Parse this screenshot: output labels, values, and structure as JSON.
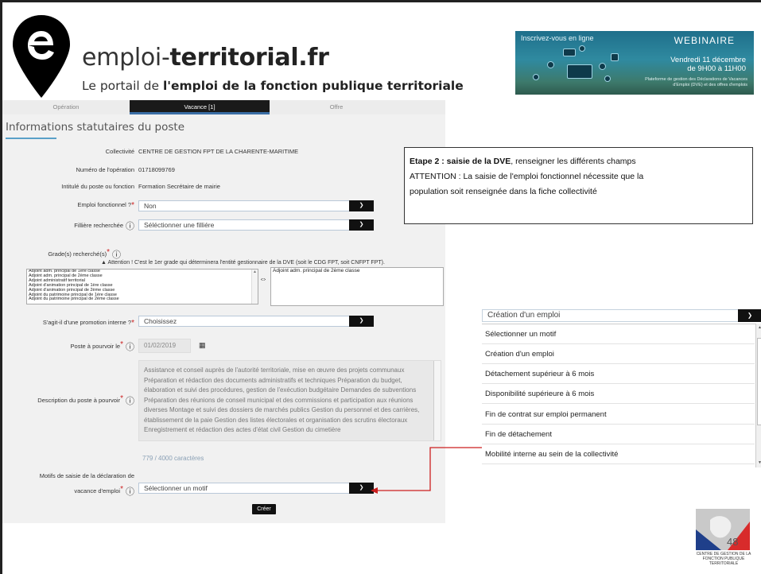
{
  "header": {
    "site_name_prefix": "emploi-",
    "site_name_bold": "territorial.fr",
    "tagline_prefix": "Le portail de ",
    "tagline_bold": "l'emploi de la fonction publique territoriale"
  },
  "banner": {
    "left_text": "Inscrivez-vous en ligne",
    "title": "WEBINAIRE",
    "date_line1": "Vendredi 11 décembre",
    "date_line2": "de 9H00 à 11H00",
    "description": "Plateforme de gestion des Déclarations de Vacances d'Emploi (DVE) et des offres d'emplois"
  },
  "tabs": [
    {
      "label": "Opération",
      "active": false
    },
    {
      "label": "Vacance [1]",
      "active": true
    },
    {
      "label": "Offre",
      "active": false
    }
  ],
  "form": {
    "section_title": "Informations statutaires du poste",
    "collectivite_label": "Collectivité",
    "collectivite_value": "CENTRE DE GESTION FPT DE LA CHARENTE-MARITIME",
    "operation_label": "Numéro de l'opération",
    "operation_value": "01718099769",
    "intitule_label": "Intitulé du poste ou fonction",
    "intitule_value": "Formation Secrétaire de mairie",
    "emploi_fonctionnel_label": "Emploi fonctionnel ?",
    "emploi_fonctionnel_value": "Non",
    "filiere_label": "Fillière recherchée",
    "filiere_value": "Séléctionner une filliére",
    "grade_label": "Grade(s) recherché(s)",
    "grade_warning": "Attention ! C'est le 1er grade qui déterminera l'entité gestionnaire de la DVE (soit le CDG FPT, soit CNFPT FPT).",
    "grade_options": [
      "Adjoint adm. principal de 1ère classe",
      "Adjoint adm. principal de 2ème classe",
      "Adjoint administratif territorial",
      "Adjoint d'animation principal de 1ère classe",
      "Adjoint d'animation principal de 2ème classe",
      "Adjoint du patrimoine principal de 1ère classe",
      "Adjoint du patrimoine principal de 2ème classe"
    ],
    "grade_selected": "Adjoint adm. principal de 2ème classe",
    "promotion_label": "S'agit-il d'une promotion interne ?",
    "promotion_value": "Choisissez",
    "poste_label": "Poste à pourvoir le",
    "poste_value": "01/02/2019",
    "description_label": "Description du poste à pourvoir",
    "description_value": "Assistance et conseil auprès de l'autorité territoriale, mise en œuvre des projets communaux Préparation et rédaction des documents administratifs et techniques Préparation du budget, élaboration et suivi des procédures, gestion de l'exécution budgétaire Demandes de subventions Préparation des réunions de conseil municipal et des commissions et participation aux réunions diverses Montage et suivi des dossiers de marchés publics Gestion du personnel et des carrières, établissement de la paie Gestion des listes électorales et organisation des scrutins électoraux Enregistrement et rédaction des actes d'état civil Gestion du cimetière",
    "char_count": "779 / 4000 caractères",
    "motifs_label_line1": "Motifs de saisie de la déclaration de",
    "motifs_label_line2": "vacance d'emploi",
    "motifs_value": "Sélectionner un motif",
    "create_button": "Créer"
  },
  "note": {
    "bold_part": "Etape 2 : saisie de la DVE",
    "rest_line1": ", renseigner les différents champs",
    "line2": "ATTENTION : La saisie de l'emploi fonctionnel nécessite que la",
    "line3": "population soit renseignée dans la fiche collectivité"
  },
  "dropdown": {
    "selected": "Création d'un emploi",
    "options": [
      "Sélectionner un motif",
      "Création d'un emploi",
      "Détachement supérieur à 6 mois",
      "Disponibilité supérieure à 6 mois",
      "Fin de contrat sur emploi permanent",
      "Fin de détachement",
      "Mobilité interne au sein de la collectivité"
    ]
  },
  "seal": {
    "number": "48",
    "text": "CENTRE DE GESTION DE LA FONCTION PUBLIQUE TERRITORIALE"
  },
  "colors": {
    "accent_red": "#cc1f1f",
    "tab_active": "#1a1a1a",
    "underline_blue": "#5aa0c8"
  }
}
